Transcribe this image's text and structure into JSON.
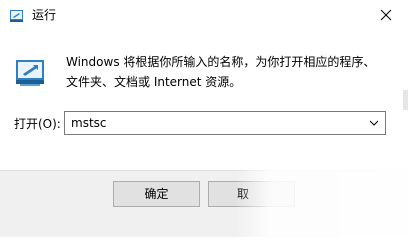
{
  "window": {
    "title": "运行"
  },
  "icons": {
    "app": "run-app-icon",
    "main": "run-dialog-icon",
    "close": "close-icon",
    "dropdown": "chevron-down-icon"
  },
  "content": {
    "description_line1": "Windows 将根据你所输入的名称，为你打开相应的程序、",
    "description_line2": "文件夹、文档或 Internet 资源。",
    "open_label": "打开(O):",
    "open_value": "mstsc"
  },
  "buttons": {
    "ok": "确定",
    "cancel": "取"
  },
  "colors": {
    "accent": "#2f7fc1",
    "footer_bg": "#f0f0f0",
    "button_bg": "#e1e1e1"
  }
}
